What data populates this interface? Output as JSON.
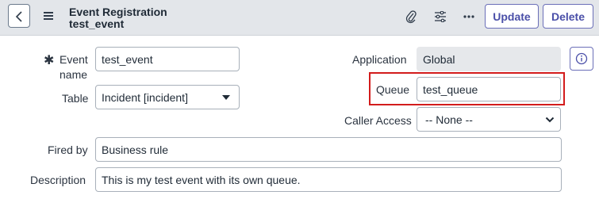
{
  "header": {
    "title_line1": "Event Registration",
    "title_line2": "test_event",
    "update_label": "Update",
    "delete_label": "Delete"
  },
  "form": {
    "required_marker": "✱",
    "event_name": {
      "label_line1": "Event",
      "label_line2": "name",
      "value": "test_event"
    },
    "table": {
      "label": "Table",
      "value": "Incident [incident]"
    },
    "application": {
      "label": "Application",
      "value": "Global"
    },
    "queue": {
      "label": "Queue",
      "value": "test_queue"
    },
    "caller_access": {
      "label": "Caller Access",
      "value": "-- None --"
    },
    "fired_by": {
      "label": "Fired by",
      "value": "Business rule"
    },
    "description": {
      "label": "Description",
      "value": "This is my test event with its own queue."
    }
  },
  "colors": {
    "highlight": "#d31c1c",
    "accent": "#4a4fa8",
    "header_bg": "#e3e6ea"
  },
  "icons": [
    "back-icon",
    "menu-icon",
    "attachment-icon",
    "settings-sliders-icon",
    "more-icon",
    "info-icon"
  ]
}
